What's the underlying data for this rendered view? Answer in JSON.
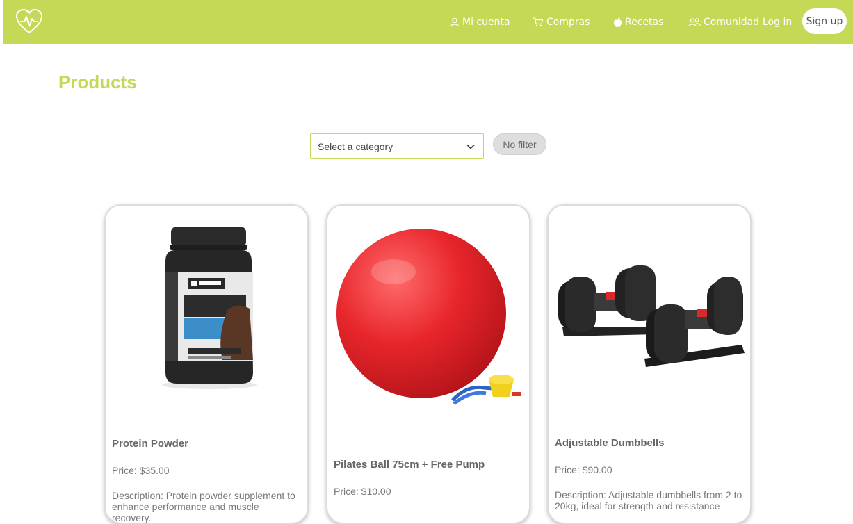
{
  "brand": {
    "accent": "#c5d957",
    "logo_icon": "heart-pulse-icon"
  },
  "nav": {
    "items": [
      {
        "label": "Mi cuenta",
        "icon": "user-icon"
      },
      {
        "label": "Compras",
        "icon": "cart-icon"
      },
      {
        "label": "Recetas",
        "icon": "apple-icon"
      },
      {
        "label": "Comunidad",
        "icon": "people-icon"
      }
    ],
    "login": "Log in",
    "signup": "Sign up"
  },
  "page": {
    "title": "Products"
  },
  "filters": {
    "select_placeholder": "Select a category",
    "clear_label": "No filter"
  },
  "products": [
    {
      "name": "Protein Powder",
      "price": "Price: $35.00",
      "description": "Description: Protein powder supplement to enhance performance and muscle recovery."
    },
    {
      "name": "Pilates Ball 75cm + Free Pump",
      "price": "Price: $10.00",
      "description": ""
    },
    {
      "name": "Adjustable Dumbbells",
      "price": "Price: $90.00",
      "description": "Description: Adjustable dumbbells from 2 to 20kg, ideal for strength and resistance"
    }
  ]
}
